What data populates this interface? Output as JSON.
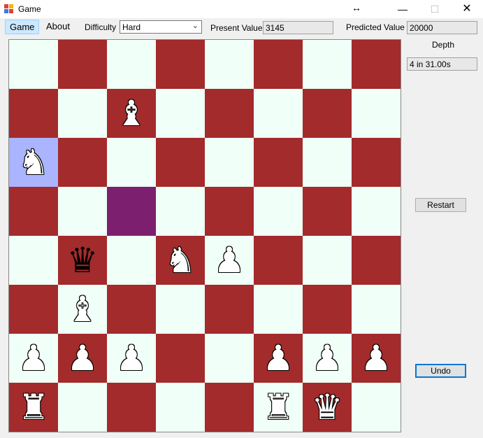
{
  "window": {
    "title": "Game"
  },
  "menu": {
    "game": "Game",
    "about": "About"
  },
  "toolbar": {
    "difficulty_label": "Difficulty",
    "difficulty_value": "Hard",
    "present_label": "Present Value",
    "present_value": "3145",
    "predicted_label": "Predicted Value",
    "predicted_value": "20000"
  },
  "side": {
    "depth_label": "Depth",
    "depth_value": "4   in 31.00s",
    "restart_label": "Restart",
    "undo_label": "Undo"
  },
  "colors": {
    "light": "#f0fff7",
    "dark": "#a32b2b",
    "selected": "#aab4ff",
    "move_hint": "#7b1f6e"
  },
  "board": {
    "highlights": {
      "a6": "selected",
      "c5": "move_hint"
    },
    "pieces": [
      {
        "square": "c7",
        "glyph": "♝",
        "color": "white",
        "name": "white-bishop"
      },
      {
        "square": "a6",
        "glyph": "♞",
        "color": "white",
        "name": "white-knight"
      },
      {
        "square": "b4",
        "glyph": "♛",
        "color": "black",
        "name": "black-queen"
      },
      {
        "square": "d4",
        "glyph": "♞",
        "color": "white",
        "name": "white-knight"
      },
      {
        "square": "e4",
        "glyph": "♟",
        "color": "white",
        "name": "white-pawn"
      },
      {
        "square": "b3",
        "glyph": "♝",
        "color": "white",
        "name": "white-bishop"
      },
      {
        "square": "a2",
        "glyph": "♟",
        "color": "white",
        "name": "white-pawn"
      },
      {
        "square": "b2",
        "glyph": "♟",
        "color": "white",
        "name": "white-pawn"
      },
      {
        "square": "c2",
        "glyph": "♟",
        "color": "white",
        "name": "white-pawn"
      },
      {
        "square": "f2",
        "glyph": "♟",
        "color": "white",
        "name": "white-pawn"
      },
      {
        "square": "g2",
        "glyph": "♟",
        "color": "white",
        "name": "white-pawn"
      },
      {
        "square": "h2",
        "glyph": "♟",
        "color": "white",
        "name": "white-pawn"
      },
      {
        "square": "a1",
        "glyph": "♜",
        "color": "white",
        "name": "white-rook"
      },
      {
        "square": "f1",
        "glyph": "♜",
        "color": "white",
        "name": "white-rook"
      },
      {
        "square": "g1",
        "glyph": "♛",
        "color": "white",
        "name": "white-queen"
      }
    ]
  }
}
